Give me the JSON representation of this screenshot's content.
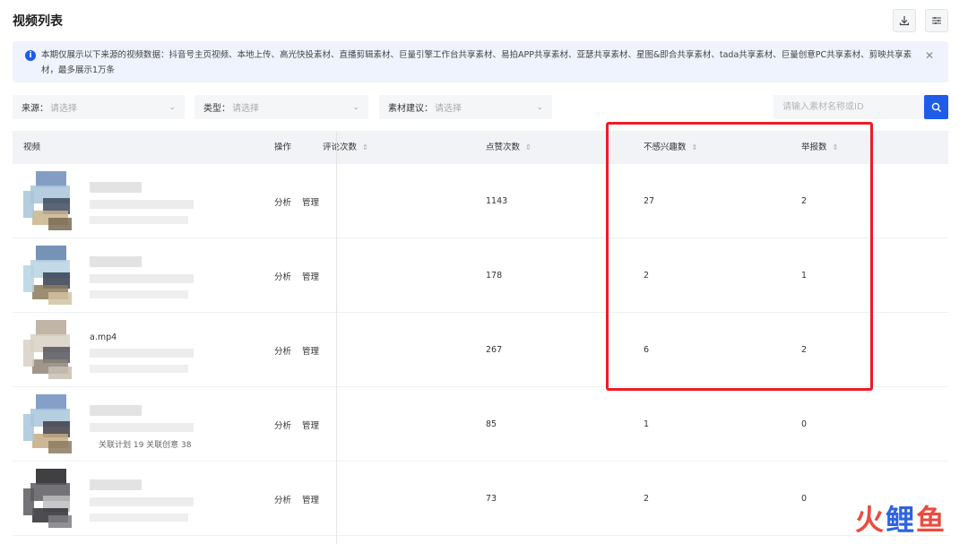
{
  "header": {
    "title": "视频列表",
    "download_icon": "download-icon",
    "settings_icon": "sliders-icon"
  },
  "notice": {
    "icon": "info-icon",
    "text": "本期仅展示以下来源的视频数据：抖音号主页视频、本地上传、高光快投素材、直播剪辑素材、巨量引擎工作台共享素材、易拍APP共享素材、亚瑟共享素材、星图&即合共享素材、tada共享素材、巨量创意PC共享素材、剪映共享素材，最多展示1万条",
    "close_icon": "close-icon"
  },
  "filters": {
    "source": {
      "label": "来源：",
      "placeholder": "请选择"
    },
    "type": {
      "label": "类型：",
      "placeholder": "请选择"
    },
    "suggestion": {
      "label": "素材建议：",
      "placeholder": "请选择"
    },
    "search": {
      "placeholder": "请输入素材名称或ID",
      "value": ""
    }
  },
  "table": {
    "columns": {
      "video": "视频",
      "operations": "操作",
      "comments": "评论次数",
      "likes": "点赞次数",
      "not_interested": "不感兴趣数",
      "reports": "举报数"
    },
    "op_analyze": "分析",
    "op_manage": "管理",
    "rows": [
      {
        "filename": "",
        "stats": "",
        "likes": "1143",
        "not_interested": "27",
        "reports": "2"
      },
      {
        "filename": "",
        "stats": "",
        "likes": "178",
        "not_interested": "2",
        "reports": "1"
      },
      {
        "filename": "a.mp4",
        "stats": "",
        "likes": "267",
        "not_interested": "6",
        "reports": "2"
      },
      {
        "filename": "",
        "stats": "关联计划 19  关联创意 38",
        "likes": "85",
        "not_interested": "1",
        "reports": "0"
      },
      {
        "filename": "",
        "stats": "",
        "likes": "73",
        "not_interested": "2",
        "reports": "0"
      }
    ]
  },
  "watermark": {
    "part1": "火",
    "part2": "鲤",
    "part3": "鱼"
  },
  "colors": {
    "accent": "#1f5ce8",
    "highlight": "#ee1c25",
    "notice_bg": "#eef3fd"
  }
}
